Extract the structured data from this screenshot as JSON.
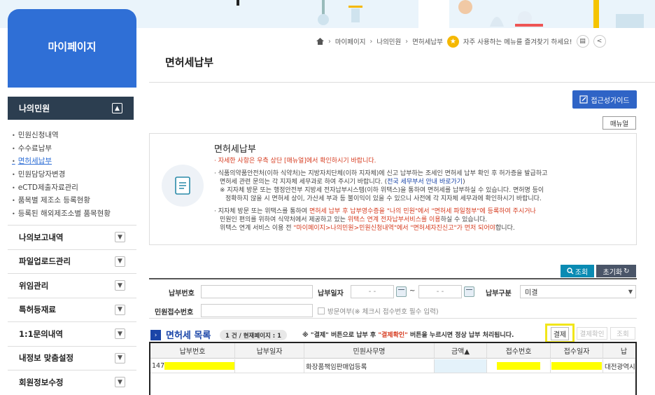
{
  "sidebar": {
    "title": "마이페이지",
    "current_section": "나의민원",
    "sub_items": [
      "민원신청내역",
      "수수료납부",
      "면허세납부",
      "민원담당자변경",
      "eCTD제출자료관리",
      "품목별 제조소 등록현황",
      "등록된 해외제조소별 품목현황"
    ],
    "active_index": 2,
    "menus": [
      "나의보고내역",
      "파일업로드관리",
      "위임관리",
      "특허등재료",
      "1:1문의내역",
      "내정보 맞춤설정",
      "회원정보수정"
    ]
  },
  "breadcrumb": {
    "items": [
      "마이페이지",
      "나의민원",
      "면허세납부"
    ],
    "favorite_text": "자주 사용하는 메뉴를 즐겨찾기 하세요!"
  },
  "page_title": "면허세납부",
  "buttons": {
    "guide": "접근성가이드",
    "manual": "매뉴얼",
    "search": "조회",
    "reset": "초기화",
    "pay": "결제",
    "pay_confirm": "결제확인",
    "query": "조회"
  },
  "info": {
    "title": "면허세납부",
    "l1": "· 자세한 사항은 우측 상단 [매뉴얼]에서 확인하시기 바랍니다.",
    "l2": "· 식품의약품안전처(이하 식약처)는 지방자치단체(이하 지자체)에 신고 납부하는 조세인 면허세 납부 확인 후 허가증을 발급하고",
    "l3a": "면허세 관련 문의는 각 지자체 세무과로 하여 주시기 바랍니다. (",
    "l3b": "전국 세무부서 안내 바로가기",
    "l3c": ")",
    "l4": "※ 지자체 방문 또는 행정안전부 지방세 전자납부시스템(이하 위택스)을 통하여 면허세를 납부하실 수 있습니다. 면허명 등이",
    "l5": "정확하지 않을 시 면허세 상이, 가산세 부과 등 불이익이 있을 수 있으니 사전에 각 지자체 세무과에 확인하시기 바랍니다.",
    "l6a": "· 지자체 방문 또는 위택스를 통하여 ",
    "l6b": "면허세 납부 후 납부영수증을 \"나의 민원\"에서 \"면허세 파일첨부\"에 등록하여 주시거나",
    "l7a": "민원인 편의를 위하여 식약처에서 제공하고 있는 ",
    "l7b": "위택스 연계 전자납부서비스를 이용",
    "l7c": "하실 수 있습니다.",
    "l8a": "위택스 연계 서비스 이용 전 ",
    "l8b": "\"마이페이지>나의민원>민원신청내역\"에서 \"면허세자진신고\"가 먼저 되어야",
    "l8c": "합니다."
  },
  "search": {
    "pay_no_label": "납부번호",
    "pay_date_label": "납부일자",
    "date_from": "-  -",
    "date_to": "-  -",
    "date_sep": "~",
    "pay_type_label": "납부구분",
    "pay_type_value": "미결",
    "receipt_label": "민원접수번호",
    "visit_label": "방문여부(※ 체크시 접수번호 필수 입력)"
  },
  "list": {
    "title": "면허세 목록",
    "count": "1 건 / 현재페이지 : 1",
    "note": "※ \"결제\" 버튼으로 납부 후 \"결제확인\" 버튼을 누르시면 정상 납부 처리됩니다.",
    "columns": [
      "납부번호",
      "납부일자",
      "민원사무명",
      "금액▲",
      "접수번호",
      "접수일자",
      "납"
    ],
    "row": {
      "pay_no": "147",
      "affair": "화장품책임판매업등록",
      "region": "대전광역시"
    }
  },
  "colors": {
    "primary": "#2f6fd6",
    "dark": "#2c3e50",
    "highlight": "#ffff00",
    "red": "#d63a1e"
  }
}
